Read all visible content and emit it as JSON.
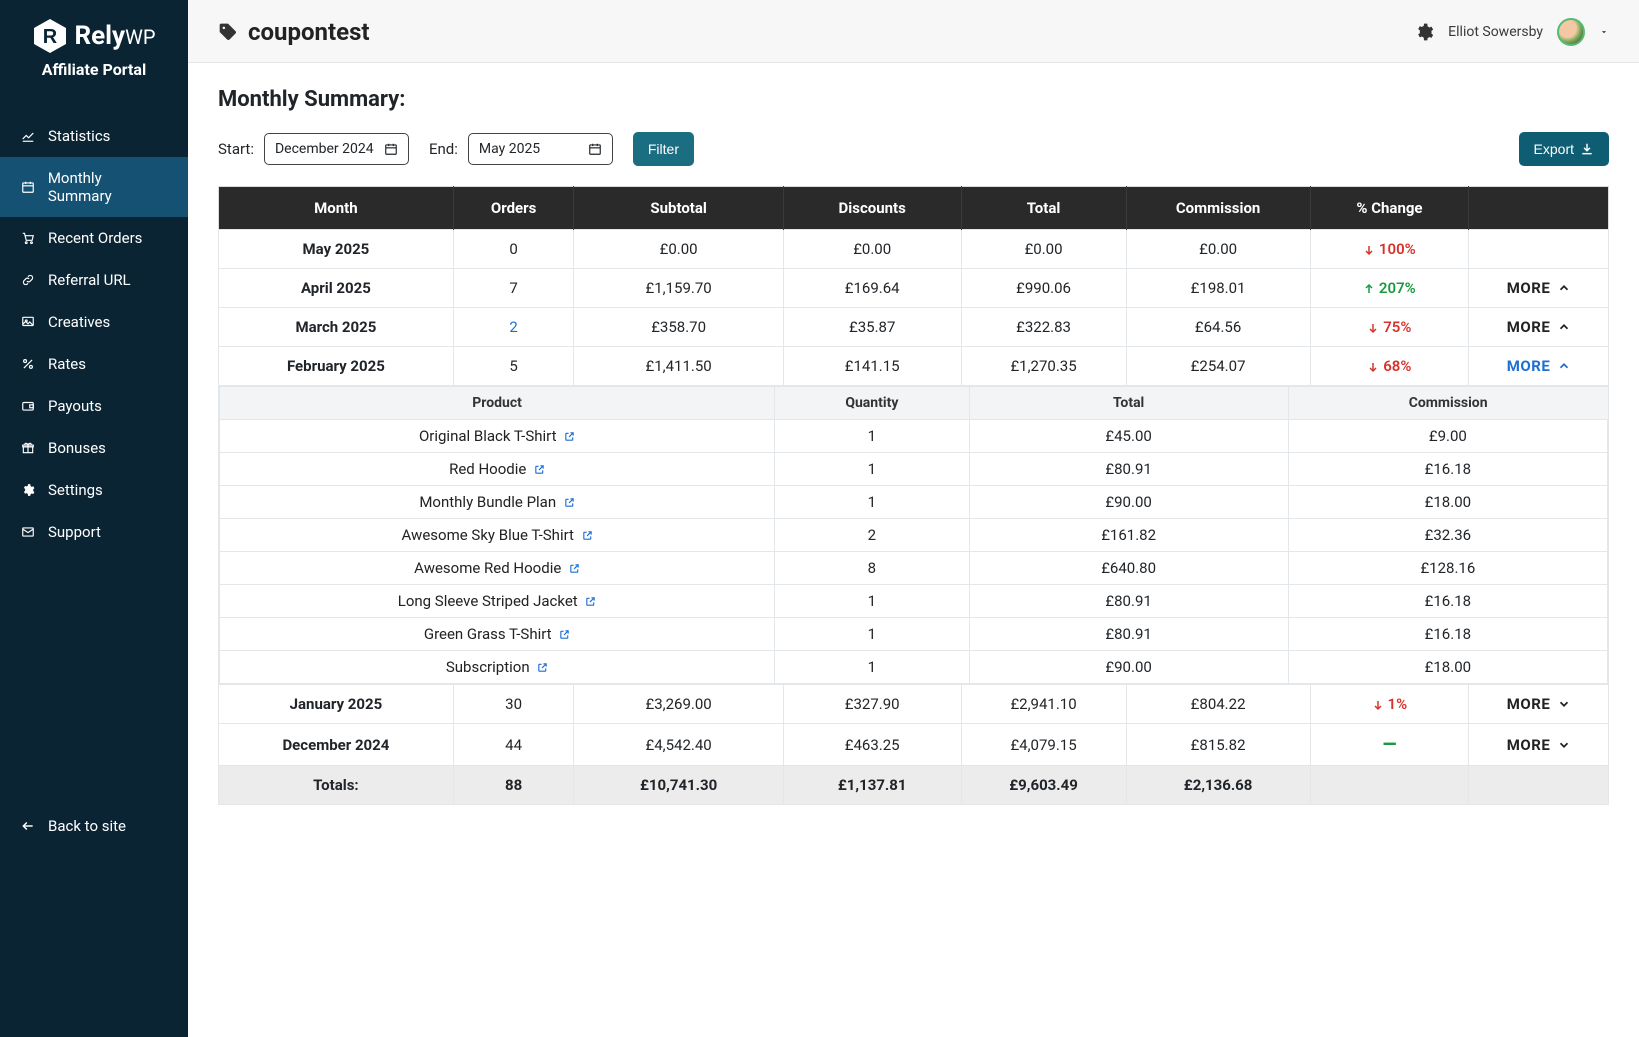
{
  "brand": {
    "name": "Rely",
    "suffix": "WP",
    "subtitle": "Affiliate Portal"
  },
  "sidebar": {
    "items": [
      {
        "label": "Statistics",
        "icon": "chart"
      },
      {
        "label": "Monthly Summary",
        "icon": "calendar",
        "active": true
      },
      {
        "label": "Recent Orders",
        "icon": "cart"
      },
      {
        "label": "Referral URL",
        "icon": "link"
      },
      {
        "label": "Creatives",
        "icon": "image"
      },
      {
        "label": "Rates",
        "icon": "percent"
      },
      {
        "label": "Payouts",
        "icon": "wallet"
      },
      {
        "label": "Bonuses",
        "icon": "gift"
      },
      {
        "label": "Settings",
        "icon": "cog"
      },
      {
        "label": "Support",
        "icon": "mail"
      }
    ],
    "back": "Back to site"
  },
  "header": {
    "title": "coupontest",
    "user": "Elliot Sowersby"
  },
  "section": {
    "title": "Monthly Summary:"
  },
  "filters": {
    "startLabel": "Start:",
    "endLabel": "End:",
    "startValue": "December 2024",
    "endValue": "May 2025",
    "filterBtn": "Filter",
    "exportBtn": "Export"
  },
  "columns": [
    "Month",
    "Orders",
    "Subtotal",
    "Discounts",
    "Total",
    "Commission",
    "% Change",
    ""
  ],
  "rows": [
    {
      "month": "May 2025",
      "orders": "0",
      "subtotal": "£0.00",
      "discounts": "£0.00",
      "total": "£0.00",
      "commission": "£0.00",
      "change": {
        "dir": "down",
        "text": "100%"
      },
      "more": ""
    },
    {
      "month": "April 2025",
      "orders": "7",
      "subtotal": "£1,159.70",
      "discounts": "£169.64",
      "total": "£990.06",
      "commission": "£198.01",
      "change": {
        "dir": "up",
        "text": "207%"
      },
      "more": "MORE",
      "moreState": "closed"
    },
    {
      "month": "March 2025",
      "orders": "2",
      "ordersLink": true,
      "subtotal": "£358.70",
      "discounts": "£35.87",
      "total": "£322.83",
      "commission": "£64.56",
      "change": {
        "dir": "down",
        "text": "75%"
      },
      "more": "MORE",
      "moreState": "closed"
    },
    {
      "month": "February 2025",
      "orders": "5",
      "subtotal": "£1,411.50",
      "discounts": "£141.15",
      "total": "£1,270.35",
      "commission": "£254.07",
      "change": {
        "dir": "down",
        "text": "68%"
      },
      "more": "MORE",
      "moreState": "open"
    },
    {
      "month": "January 2025",
      "orders": "30",
      "subtotal": "£3,269.00",
      "discounts": "£327.90",
      "total": "£2,941.10",
      "commission": "£804.22",
      "change": {
        "dir": "down",
        "text": "1%"
      },
      "more": "MORE",
      "moreState": "collapsed"
    },
    {
      "month": "December 2024",
      "orders": "44",
      "subtotal": "£4,542.40",
      "discounts": "£463.25",
      "total": "£4,079.15",
      "commission": "£815.82",
      "change": {
        "dir": "neutral",
        "text": "—"
      },
      "more": "MORE",
      "moreState": "collapsed"
    }
  ],
  "detailHeaders": [
    "Product",
    "Quantity",
    "Total",
    "Commission"
  ],
  "detailRows": [
    {
      "product": "Original Black T-Shirt",
      "qty": "1",
      "total": "£45.00",
      "commission": "£9.00"
    },
    {
      "product": "Red Hoodie",
      "qty": "1",
      "total": "£80.91",
      "commission": "£16.18"
    },
    {
      "product": "Monthly Bundle Plan",
      "qty": "1",
      "total": "£90.00",
      "commission": "£18.00"
    },
    {
      "product": "Awesome Sky Blue T-Shirt",
      "qty": "2",
      "total": "£161.82",
      "commission": "£32.36"
    },
    {
      "product": "Awesome Red Hoodie",
      "qty": "8",
      "total": "£640.80",
      "commission": "£128.16"
    },
    {
      "product": "Long Sleeve Striped Jacket",
      "qty": "1",
      "total": "£80.91",
      "commission": "£16.18"
    },
    {
      "product": "Green Grass T-Shirt",
      "qty": "1",
      "total": "£80.91",
      "commission": "£16.18"
    },
    {
      "product": "Subscription",
      "qty": "1",
      "total": "£90.00",
      "commission": "£18.00"
    }
  ],
  "totals": {
    "label": "Totals:",
    "orders": "88",
    "subtotal": "£10,741.30",
    "discounts": "£1,137.81",
    "total": "£9,603.49",
    "commission": "£2,136.68"
  }
}
